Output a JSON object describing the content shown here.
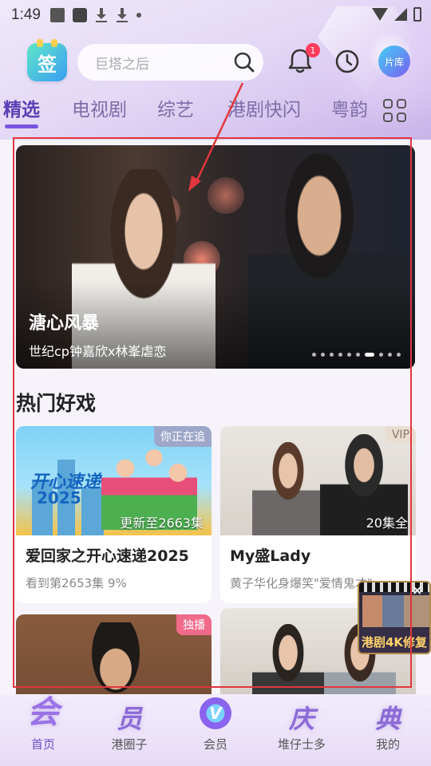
{
  "status_bar": {
    "time": "1:49"
  },
  "header": {
    "app_logo_text": "签",
    "search_placeholder": "巨塔之后",
    "notification_count": "1",
    "library_label": "片库"
  },
  "tabs": [
    {
      "label": "精选",
      "active": true
    },
    {
      "label": "电视剧",
      "active": false
    },
    {
      "label": "综艺",
      "active": false
    },
    {
      "label": "港剧快闪",
      "active": false
    },
    {
      "label": "粤韵",
      "active": false
    }
  ],
  "banner": {
    "title": "溏心风暴",
    "subtitle": "世纪cp钟嘉欣x林峯虐恋",
    "page_count": 10,
    "active_page": 7
  },
  "section": {
    "title": "热门好戏"
  },
  "cards": [
    {
      "tag": "你正在追",
      "tag_color": "#9ea7c9",
      "episode_info": "更新至2663集",
      "title": "爱回家之开心速递2025",
      "subtitle": "看到第2653集 9%",
      "thumb_logo": "开心速递",
      "thumb_year": "2025"
    },
    {
      "tag": "VIP",
      "tag_color": "#e9ded1",
      "episode_info": "20集全",
      "title": "My盛Lady",
      "subtitle": "黄子华化身爆笑\"爱情鬼才\""
    },
    {
      "tag": "独播",
      "tag_color": "#f06a8a"
    },
    {
      "tag": ""
    }
  ],
  "float_promo": {
    "text": "港剧4K修复",
    "close": "×"
  },
  "bottom_nav": [
    {
      "deco": "会",
      "label": "首页",
      "active": true
    },
    {
      "deco": "员",
      "label": "港圈子",
      "active": false
    },
    {
      "deco": "V",
      "label": "会员",
      "active": false
    },
    {
      "deco": "庆",
      "label": "堆仔士多",
      "active": false
    },
    {
      "deco": "典",
      "label": "我的",
      "active": false
    }
  ]
}
